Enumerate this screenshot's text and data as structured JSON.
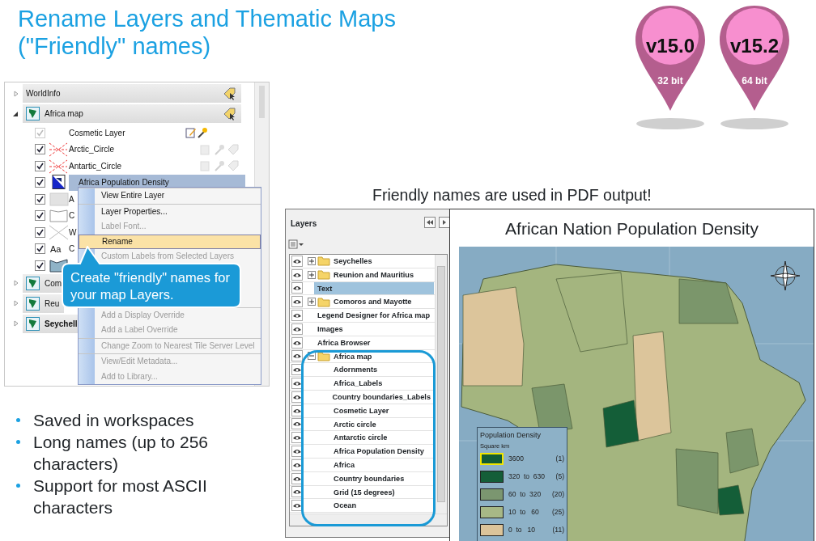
{
  "title_lines": [
    "Rename Layers and Thematic Maps",
    "(\"Friendly\" names)"
  ],
  "version_pins": [
    {
      "version": "v15.0",
      "bits": "32 bit"
    },
    {
      "version": "v15.2",
      "bits": "64 bit"
    }
  ],
  "layer_tree": {
    "groups": [
      {
        "label": "WorldInfo",
        "kind": "info",
        "expanded": false,
        "active": false,
        "label_tool": true
      },
      {
        "label": "Africa map",
        "kind": "map",
        "expanded": true,
        "active": false,
        "label_tool": true,
        "children": [
          {
            "label": "Cosmetic Layer",
            "kind": "cosmetic",
            "checked": true,
            "disabled": true,
            "selected": false,
            "tools_enabled": true
          },
          {
            "label": "Arctic_Circle",
            "kind": "line",
            "checked": true,
            "disabled": false,
            "selected": false,
            "tools_enabled": false
          },
          {
            "label": "Antartic_Circle",
            "kind": "line",
            "checked": true,
            "disabled": false,
            "selected": false,
            "tools_enabled": false
          },
          {
            "label": "Africa Population Density",
            "kind": "thematic",
            "checked": true,
            "disabled": false,
            "selected": true
          },
          {
            "label": "A",
            "kind": "region",
            "checked": true,
            "disabled": false,
            "selected": false
          },
          {
            "label": "C",
            "kind": "outline",
            "checked": true,
            "disabled": false,
            "selected": false
          },
          {
            "label": "W",
            "kind": "grid",
            "checked": true,
            "disabled": false,
            "selected": false
          },
          {
            "label": "C",
            "kind": "text",
            "symbol_text": "Aa",
            "checked": true,
            "disabled": false,
            "selected": false
          },
          {
            "kind": "polygon",
            "checked": true,
            "disabled": false,
            "selected": false
          }
        ]
      },
      {
        "label": "Com",
        "kind": "map",
        "expanded": false,
        "active": false,
        "label_tool": false
      },
      {
        "label": "Reu",
        "kind": "map",
        "expanded": false,
        "active": false,
        "label_tool": false
      },
      {
        "label": "Seychell",
        "kind": "map",
        "expanded": false,
        "active": true,
        "label_tool": false
      }
    ]
  },
  "context_menu": {
    "sections": [
      [
        {
          "label": "View Entire Layer",
          "disabled": false,
          "selected": false
        }
      ],
      [
        {
          "label": "Layer Properties...",
          "disabled": false,
          "selected": false
        },
        {
          "label": "Label Font...",
          "disabled": true,
          "selected": false
        },
        {
          "label": "Rename",
          "disabled": false,
          "selected": true
        },
        {
          "label": "Custom Labels from Selected Layers",
          "disabled": true,
          "selected": false
        }
      ],
      [
        {
          "label": "Add a Display Override",
          "disabled": true,
          "selected": false
        },
        {
          "label": "Add a Label Override",
          "disabled": true,
          "selected": false
        }
      ],
      [
        {
          "label": "Change Zoom to Nearest Tile Server Level",
          "disabled": true,
          "selected": false
        }
      ],
      [
        {
          "label": "View/Edit Metadata...",
          "disabled": true,
          "selected": false
        },
        {
          "label": "Add to Library...",
          "disabled": true,
          "selected": false
        }
      ]
    ]
  },
  "callout": "Create \"friendly\" names for your map Layers.",
  "bullets": [
    "Saved in workspaces",
    "Long names (up to 256 characters)",
    "Support for most ASCII characters"
  ],
  "caption": "Friendly names are used in PDF output!",
  "layers_panel": {
    "title": "Layers",
    "rows": [
      {
        "label": "Seychelles",
        "kind": "folder",
        "expanded": false,
        "selected": false
      },
      {
        "label": "Reunion and Mauritius",
        "kind": "folder",
        "expanded": false,
        "selected": false
      },
      {
        "label": "Text",
        "kind": "layer",
        "selected": true
      },
      {
        "label": "Comoros and Mayotte",
        "kind": "folder",
        "expanded": false,
        "selected": false
      },
      {
        "label": "Legend Designer for Africa map",
        "kind": "layer",
        "selected": false
      },
      {
        "label": "Images",
        "kind": "layer",
        "selected": false
      },
      {
        "label": "Africa Browser",
        "kind": "layer",
        "selected": false
      },
      {
        "label": "Africa map",
        "kind": "folder",
        "expanded": true,
        "selected": false,
        "children": [
          {
            "label": "Adornments",
            "selected": false
          },
          {
            "label": "Africa_Labels",
            "selected": false
          },
          {
            "label": "Country boundaries_Labels",
            "selected": false
          },
          {
            "label": "Cosmetic Layer",
            "selected": false
          },
          {
            "label": "Arctic circle",
            "selected": false
          },
          {
            "label": "Antarctic circle",
            "selected": false
          },
          {
            "label": "Africa Population Density",
            "selected": false
          },
          {
            "label": "Africa",
            "selected": false
          },
          {
            "label": "Country boundaries",
            "selected": false
          },
          {
            "label": "Grid (15 degrees)",
            "selected": false
          },
          {
            "label": "Ocean",
            "selected": false
          }
        ]
      }
    ]
  },
  "map_window": {
    "title": "African Nation Population Density",
    "legend": {
      "title": "Population Density",
      "subtitle": "Square km",
      "classes": [
        {
          "range": "3600",
          "count": "(1)",
          "color": "#125c36",
          "selected": true
        },
        {
          "range": "320  to  630",
          "count": "(5)",
          "color": "#145e38",
          "selected": false
        },
        {
          "range": "60  to  320",
          "count": "(20)",
          "color": "#7b9670",
          "selected": false
        },
        {
          "range": "10  to   60",
          "count": "(25)",
          "color": "#a7b886",
          "selected": false
        },
        {
          "range": "0  to   10",
          "count": "(11)",
          "color": "#dcc49a",
          "selected": false
        }
      ]
    }
  }
}
